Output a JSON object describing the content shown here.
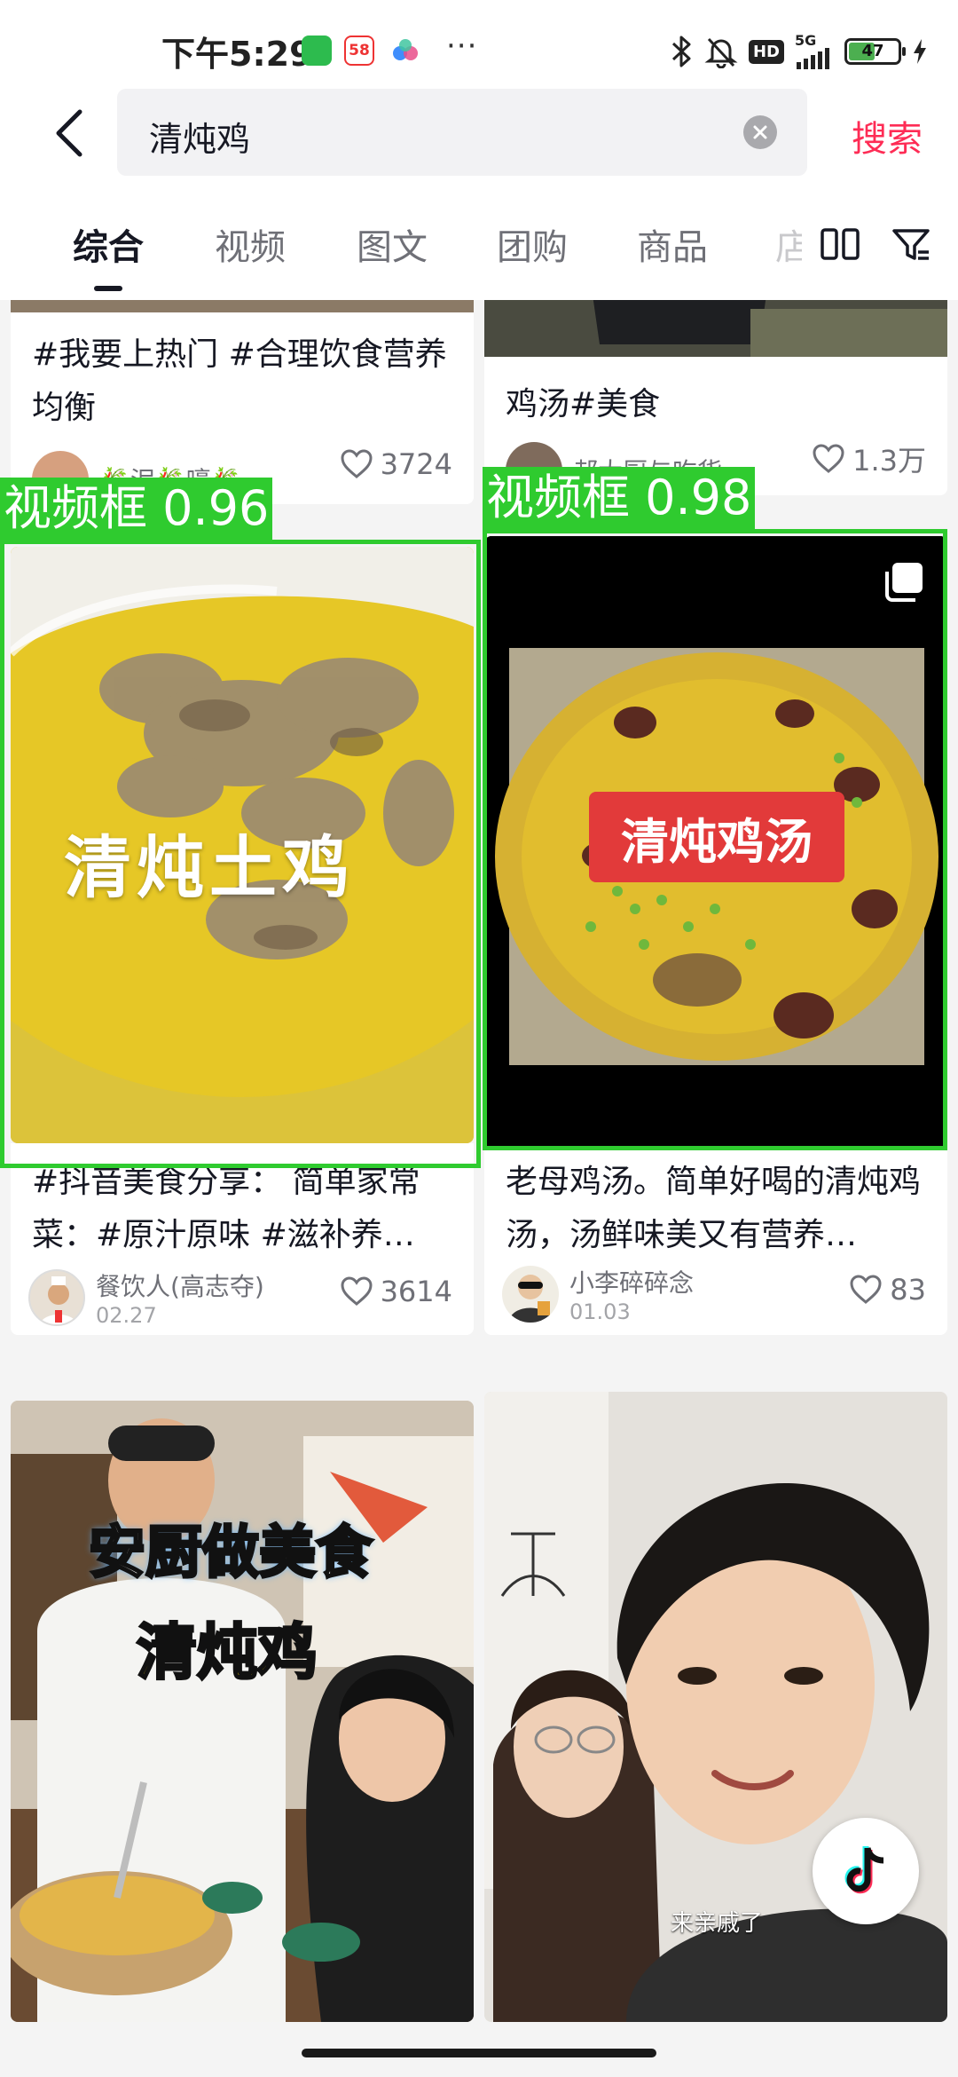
{
  "status_bar": {
    "time": "下午5:29",
    "app_badge_58": "58",
    "more": "···",
    "hd": "HD",
    "network": "5G",
    "battery": "47"
  },
  "search": {
    "back_icon": "chevron-left-icon",
    "query": "清炖鸡",
    "clear_icon": "clear-icon",
    "submit_label": "搜索"
  },
  "tabs": {
    "items": [
      {
        "label": "综合",
        "active": true
      },
      {
        "label": "视频",
        "active": false
      },
      {
        "label": "图文",
        "active": false
      },
      {
        "label": "团购",
        "active": false
      },
      {
        "label": "商品",
        "active": false
      },
      {
        "label": "店",
        "active": false
      }
    ],
    "layout_icon": "double-column-icon",
    "filter_icon": "filter-icon"
  },
  "feed": {
    "top_left": {
      "title": "#我要上热门 #合理饮食营养均衡",
      "author": "🎋泥🎋嚎🎋",
      "likes": "3724"
    },
    "top_right": {
      "title": "鸡汤#美食",
      "author": "郝大厨与吃货",
      "likes": "1.3万"
    },
    "mid_left": {
      "overlay": "清炖土鸡",
      "detection": "视频框 0.96",
      "title": "#抖音美食分享： 简单家常菜：#原汁原味 #滋补养…",
      "author": "餐饮人(高志夺)",
      "date": "02.27",
      "likes": "3614"
    },
    "mid_right": {
      "overlay": "清炖鸡汤",
      "detection": "视频框 0.98",
      "title": "老母鸡汤。简单好喝的清炖鸡汤，汤鲜味美又有营养…",
      "author": "小李碎碎念",
      "date": "01.03",
      "likes": "83"
    },
    "bottom_left": {
      "overlay_line1": "安厨做美食",
      "overlay_line2": "清炖鸡"
    },
    "bottom_right": {
      "caption": "来亲戚了"
    }
  },
  "colors": {
    "accent": "#fe2c55",
    "detection_green": "#2fcb2f",
    "soup_yellow": "#e9c51f"
  }
}
